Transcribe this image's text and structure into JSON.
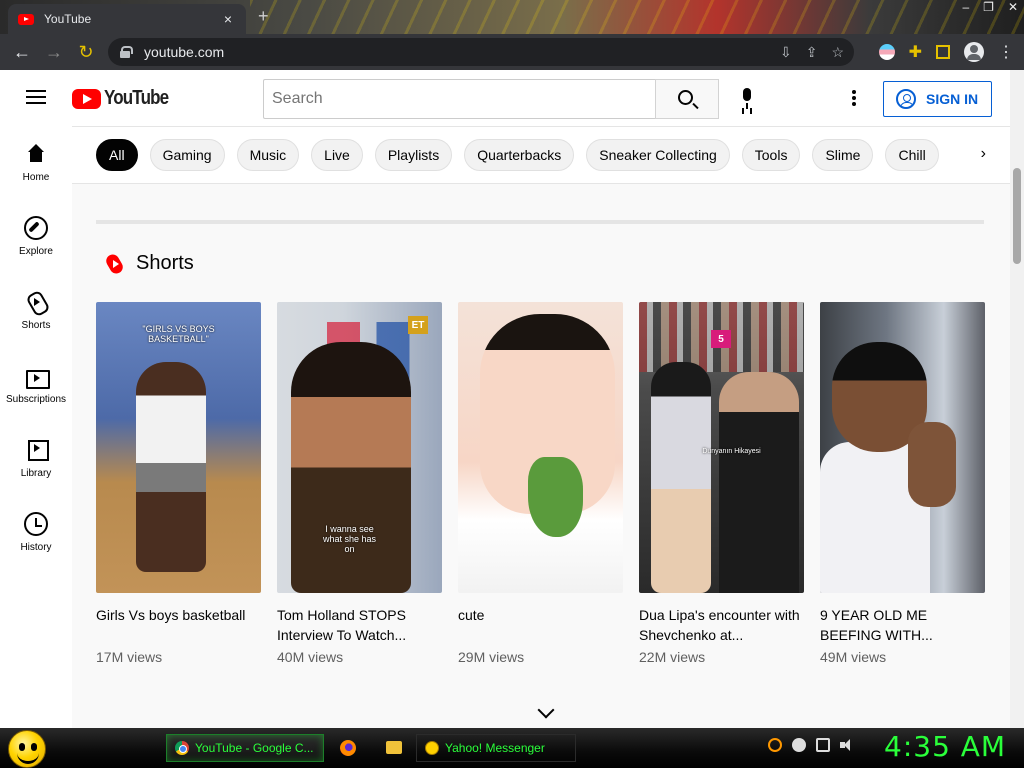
{
  "browser": {
    "tab_title": "YouTube",
    "tab_close": "×",
    "new_tab": "+",
    "url": "youtube.com",
    "window_controls": [
      "–",
      "❐",
      "✕"
    ],
    "nav": {
      "back": "←",
      "forward": "→",
      "reload": "↻"
    },
    "omnibox_icons": [
      "⇩",
      "⇪",
      "☆"
    ],
    "menu": "⋮"
  },
  "youtube": {
    "logo_text": "YouTube",
    "search_placeholder": "Search",
    "sign_in": "SIGN IN",
    "chips": [
      "All",
      "Gaming",
      "Music",
      "Live",
      "Playlists",
      "Quarterbacks",
      "Sneaker Collecting",
      "Tools",
      "Slime",
      "Chill"
    ],
    "active_chip": "All",
    "chip_next": "›",
    "sidebar": [
      {
        "label": "Home",
        "icon": "home-icon"
      },
      {
        "label": "Explore",
        "icon": "explore-icon"
      },
      {
        "label": "Shorts",
        "icon": "shorts-icon"
      },
      {
        "label": "Subscriptions",
        "icon": "subscriptions-icon"
      },
      {
        "label": "Library",
        "icon": "library-icon"
      },
      {
        "label": "History",
        "icon": "history-icon"
      }
    ],
    "shelf_title": "Shorts",
    "shorts": [
      {
        "title": "Girls Vs boys basketball",
        "views": "17M views",
        "overlay": "\"GIRLS VS BOYS BASKETBALL\""
      },
      {
        "title": "Tom Holland STOPS Interview To Watch...",
        "views": "40M views",
        "overlay": "I wanna see what she has on",
        "badge": "ET"
      },
      {
        "title": "cute",
        "views": "29M views"
      },
      {
        "title": "Dua Lipa's encounter with Shevchenko at...",
        "views": "22M views",
        "overlay": "Dunyanın Hikayesi",
        "badge": "5"
      },
      {
        "title": "9 YEAR OLD ME BEEFING WITH...",
        "views": "49M views"
      }
    ]
  },
  "taskbar": {
    "items": [
      {
        "label": "YouTube - Google C...",
        "icon": "chrome-icon",
        "active": true
      },
      {
        "label": "Yahoo! Messenger",
        "icon": "yahoo-messenger-icon",
        "active": false
      }
    ],
    "clock": "4:35 AM"
  },
  "colors": {
    "youtube_red": "#ff0000",
    "signin_blue": "#065fd4",
    "taskbar_green": "#2aff3a",
    "chrome_dark": "#35363a"
  }
}
